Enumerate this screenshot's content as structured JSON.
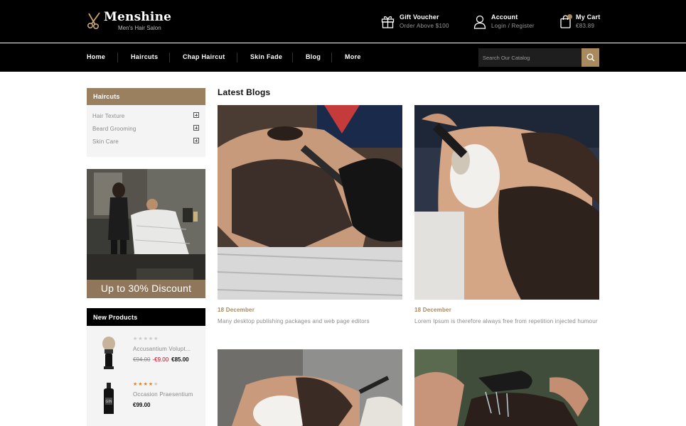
{
  "brand": {
    "name": "Menshine",
    "tagline": "Men's Hair Salon"
  },
  "header": {
    "gift": {
      "title": "Gift Voucher",
      "sub": "Order Above $100"
    },
    "account": {
      "title": "Account",
      "sub": "Login / Register"
    },
    "cart": {
      "title": "My Cart",
      "sub": "€83.89",
      "count": ""
    }
  },
  "nav": {
    "items": [
      "Home",
      "Haircuts",
      "Chap Haircut",
      "Skin Fade",
      "Blog",
      "More"
    ]
  },
  "search": {
    "placeholder": "Search Our Catalog",
    "icon": "search-icon"
  },
  "sidebar": {
    "categories_title": "Haircuts",
    "categories": [
      "Hair Texture",
      "Beard Grooming",
      "Skin Care"
    ],
    "promo_text": "Up to 30% Discount",
    "new_products_title": "New Products",
    "products": [
      {
        "name": "Accusantium Volupt...",
        "rating": 0,
        "old_price": "€94.00",
        "discount": "-€9.00",
        "price": "€85.00"
      },
      {
        "name": "Occasion Praesentium",
        "rating": 4,
        "old_price": "",
        "discount": "",
        "price": "€99.00"
      }
    ]
  },
  "main": {
    "title": "Latest Blogs",
    "posts": [
      {
        "date": "18 December",
        "text": "Many desktop publishing packages and web page editors"
      },
      {
        "date": "18 December",
        "text": "Lorem Ipsum is therefore always free from repetition injected humour"
      },
      {
        "date": "",
        "text": ""
      },
      {
        "date": "",
        "text": ""
      }
    ]
  },
  "colors": {
    "accent": "#a88a5e",
    "header_bg": "#000000",
    "category_head": "#9b8060",
    "discount": "#d0021b"
  }
}
